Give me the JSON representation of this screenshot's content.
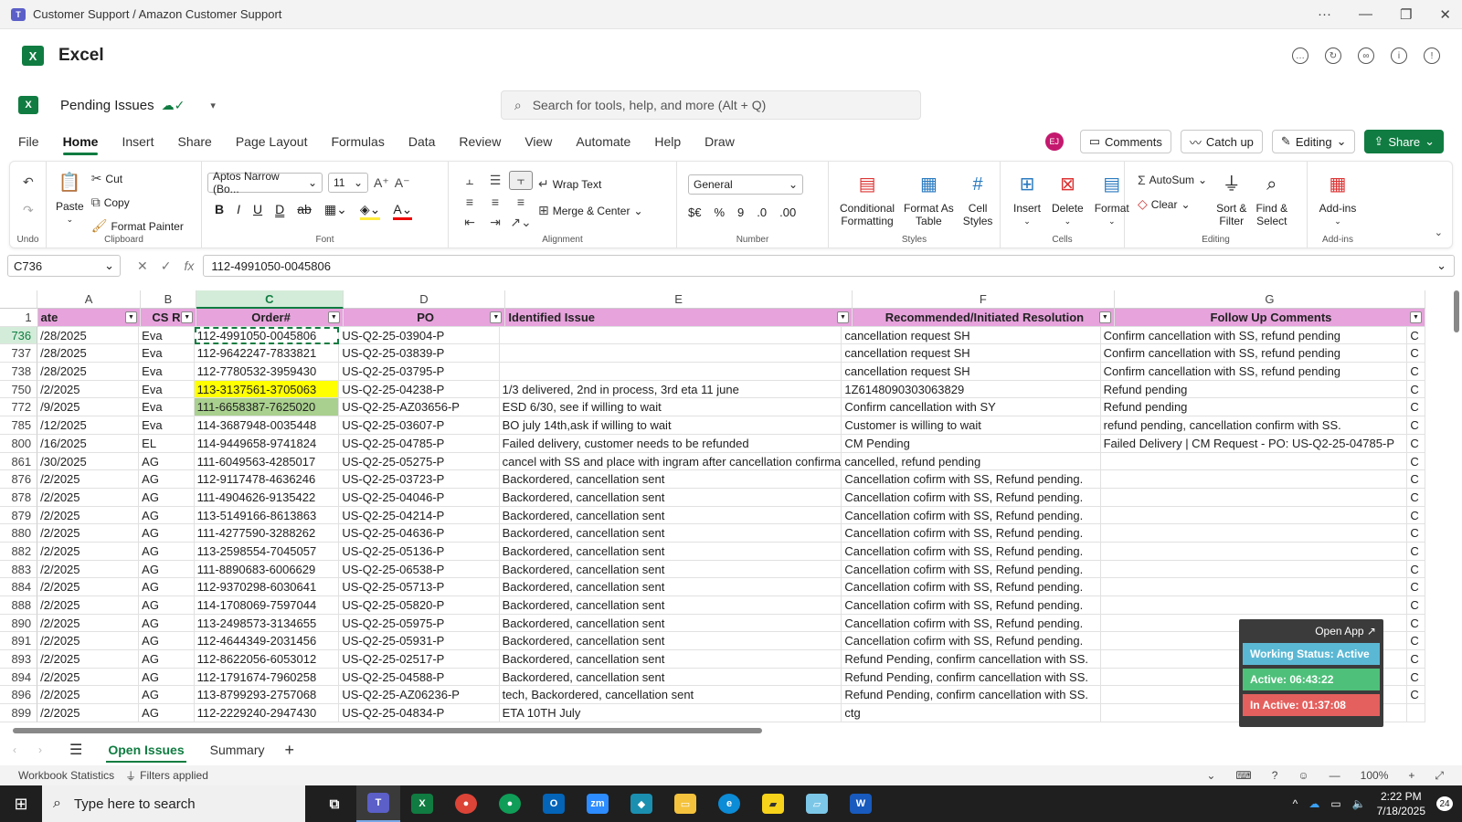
{
  "window": {
    "title": "Customer Support / Amazon Customer Support",
    "controls": [
      "···",
      "—",
      "❐",
      "✕"
    ]
  },
  "app": {
    "name": "Excel",
    "logo": "X"
  },
  "doc": {
    "name": "Pending Issues"
  },
  "search": {
    "placeholder": "Search for tools, help, and more (Alt + Q)"
  },
  "menu": [
    "File",
    "Home",
    "Insert",
    "Share",
    "Page Layout",
    "Formulas",
    "Data",
    "Review",
    "View",
    "Automate",
    "Help",
    "Draw"
  ],
  "header_right": {
    "avatar": "EJ",
    "comments": "Comments",
    "catchup": "Catch up",
    "editing": "Editing",
    "share": "Share"
  },
  "ribbon": {
    "undo_label": "Undo",
    "clipboard": {
      "paste": "Paste",
      "cut": "Cut",
      "copy": "Copy",
      "format_painter": "Format Painter",
      "label": "Clipboard"
    },
    "font": {
      "name": "Aptos Narrow (Bo...",
      "size": "11",
      "label": "Font"
    },
    "alignment": {
      "wrap": "Wrap Text",
      "merge": "Merge & Center",
      "label": "Alignment"
    },
    "number": {
      "format": "General",
      "currency": "$€",
      "percent": "%",
      "comma": "9",
      "label": "Number"
    },
    "styles": {
      "cond1": "Conditional",
      "cond2": "Formatting",
      "fat1": "Format As",
      "fat2": "Table",
      "cs1": "Cell",
      "cs2": "Styles",
      "label": "Styles"
    },
    "cells": {
      "insert": "Insert",
      "delete": "Delete",
      "format": "Format",
      "label": "Cells"
    },
    "editing": {
      "autosum": "AutoSum",
      "clear": "Clear",
      "sort1": "Sort &",
      "sort2": "Filter",
      "find1": "Find &",
      "find2": "Select",
      "label": "Editing"
    },
    "addins": {
      "name": "Add-ins",
      "label": "Add-ins"
    }
  },
  "formula_bar": {
    "namebox": "C736",
    "fx": "fx",
    "value": "112-4991050-0045806"
  },
  "columns": {
    "letters": [
      "A",
      "B",
      "C",
      "D",
      "E",
      "F",
      "G"
    ]
  },
  "header_row": {
    "num": "1",
    "cells": [
      "ate",
      "CS Re",
      "Order#",
      "PO",
      "Identified Issue",
      "Recommended/Initiated Resolution",
      "Follow Up Comments"
    ]
  },
  "rows": [
    {
      "n": "736",
      "a": "/28/2025",
      "b": "Eva",
      "c": "112-4991050-0045806",
      "d": "US-Q2-25-03904-P",
      "e": "",
      "f": "cancellation request SH",
      "g": "Confirm cancellation with SS, refund pending",
      "h": "C"
    },
    {
      "n": "737",
      "a": "/28/2025",
      "b": "Eva",
      "c": "112-9642247-7833821",
      "d": "US-Q2-25-03839-P",
      "e": "",
      "f": "cancellation request SH",
      "g": "Confirm cancellation with SS, refund pending",
      "h": "C"
    },
    {
      "n": "738",
      "a": "/28/2025",
      "b": "Eva",
      "c": "112-7780532-3959430",
      "d": "US-Q2-25-03795-P",
      "e": "",
      "f": "cancellation request SH",
      "g": "Confirm cancellation with SS, refund pending",
      "h": "C"
    },
    {
      "n": "750",
      "a": "/2/2025",
      "b": "Eva",
      "c": "113-3137561-3705063",
      "d": "US-Q2-25-04238-P",
      "e": "1/3 delivered, 2nd in process, 3rd eta 11 june",
      "f": "1Z6148090303063829",
      "g": "Refund pending",
      "h": "C"
    },
    {
      "n": "772",
      "a": "/9/2025",
      "b": "Eva",
      "c": "111-6658387-7625020",
      "d": "US-Q2-25-AZ03656-P",
      "e": "ESD 6/30, see if willing to wait",
      "f": "Confirm cancellation with SY",
      "g": "Refund pending",
      "h": "C"
    },
    {
      "n": "785",
      "a": "/12/2025",
      "b": "Eva",
      "c": "114-3687948-0035448",
      "d": "US-Q2-25-03607-P",
      "e": "BO july 14th,ask if willing to wait",
      "f": "Customer is willing to wait",
      "g": "refund pending, cancellation confirm with SS.",
      "h": "C"
    },
    {
      "n": "800",
      "a": "/16/2025",
      "b": "EL",
      "c": "114-9449658-9741824",
      "d": "US-Q2-25-04785-P",
      "e": "Failed delivery, customer needs to be refunded",
      "f": "CM Pending",
      "g": "Failed Delivery | CM Request - PO: US-Q2-25-04785-P",
      "h": "C"
    },
    {
      "n": "861",
      "a": "/30/2025",
      "b": "AG",
      "c": "111-6049563-4285017",
      "d": "US-Q2-25-05275-P",
      "e": "cancel with SS and place with ingram after cancellation confirma",
      "f": "cancelled, refund pending",
      "g": "",
      "h": "C"
    },
    {
      "n": "876",
      "a": "/2/2025",
      "b": "AG",
      "c": "112-9117478-4636246",
      "d": "US-Q2-25-03723-P",
      "e": "Backordered, cancellation sent",
      "f": "Cancellation cofirm with SS, Refund pending.",
      "g": "",
      "h": "C"
    },
    {
      "n": "878",
      "a": "/2/2025",
      "b": "AG",
      "c": "111-4904626-9135422",
      "d": "US-Q2-25-04046-P",
      "e": "Backordered, cancellation sent",
      "f": "Cancellation cofirm with SS, Refund pending.",
      "g": "",
      "h": "C"
    },
    {
      "n": "879",
      "a": "/2/2025",
      "b": "AG",
      "c": "113-5149166-8613863",
      "d": "US-Q2-25-04214-P",
      "e": "Backordered, cancellation sent",
      "f": "Cancellation cofirm with SS, Refund pending.",
      "g": "",
      "h": "C"
    },
    {
      "n": "880",
      "a": "/2/2025",
      "b": "AG",
      "c": "111-4277590-3288262",
      "d": "US-Q2-25-04636-P",
      "e": "Backordered, cancellation sent",
      "f": "Cancellation cofirm with SS, Refund pending.",
      "g": "",
      "h": "C"
    },
    {
      "n": "882",
      "a": "/2/2025",
      "b": "AG",
      "c": "113-2598554-7045057",
      "d": "US-Q2-25-05136-P",
      "e": "Backordered, cancellation sent",
      "f": "Cancellation cofirm with SS, Refund pending.",
      "g": "",
      "h": "C"
    },
    {
      "n": "883",
      "a": "/2/2025",
      "b": "AG",
      "c": "111-8890683-6006629",
      "d": "US-Q2-25-06538-P",
      "e": "Backordered, cancellation sent",
      "f": "Cancellation cofirm with SS, Refund pending.",
      "g": "",
      "h": "C"
    },
    {
      "n": "884",
      "a": "/2/2025",
      "b": "AG",
      "c": "112-9370298-6030641",
      "d": "US-Q2-25-05713-P",
      "e": "Backordered, cancellation sent",
      "f": "Cancellation cofirm with SS, Refund pending.",
      "g": "",
      "h": "C"
    },
    {
      "n": "888",
      "a": "/2/2025",
      "b": "AG",
      "c": "114-1708069-7597044",
      "d": "US-Q2-25-05820-P",
      "e": "Backordered, cancellation sent",
      "f": "Cancellation cofirm with SS, Refund pending.",
      "g": "",
      "h": "C"
    },
    {
      "n": "890",
      "a": "/2/2025",
      "b": "AG",
      "c": "113-2498573-3134655",
      "d": "US-Q2-25-05975-P",
      "e": "Backordered, cancellation sent",
      "f": "Cancellation cofirm with SS, Refund pending.",
      "g": "",
      "h": "C"
    },
    {
      "n": "891",
      "a": "/2/2025",
      "b": "AG",
      "c": "112-4644349-2031456",
      "d": "US-Q2-25-05931-P",
      "e": "Backordered, cancellation sent",
      "f": "Cancellation cofirm with SS, Refund pending.",
      "g": "",
      "h": "C"
    },
    {
      "n": "893",
      "a": "/2/2025",
      "b": "AG",
      "c": "112-8622056-6053012",
      "d": "US-Q2-25-02517-P",
      "e": "Backordered, cancellation sent",
      "f": "Refund Pending, confirm cancellation with SS.",
      "g": "",
      "h": "C"
    },
    {
      "n": "894",
      "a": "/2/2025",
      "b": "AG",
      "c": "112-1791674-7960258",
      "d": "US-Q2-25-04588-P",
      "e": "Backordered, cancellation sent",
      "f": "Refund Pending, confirm cancellation with SS.",
      "g": "",
      "h": "C"
    },
    {
      "n": "896",
      "a": "/2/2025",
      "b": "AG",
      "c": "113-8799293-2757068",
      "d": "US-Q2-25-AZ06236-P",
      "e": "tech, Backordered, cancellation sent",
      "f": "Refund Pending, confirm cancellation with SS.",
      "g": "",
      "h": "C"
    },
    {
      "n": "899",
      "a": "/2/2025",
      "b": "AG",
      "c": "112-2229240-2947430",
      "d": "US-Q2-25-04834-P",
      "e": "ETA 10TH July",
      "f": "ctg",
      "g": "",
      "h": ""
    }
  ],
  "widget": {
    "open_app": "Open App ↗",
    "status": "Working Status: Active",
    "active": "Active: 06:43:22",
    "inactive": "In Active: 01:37:08",
    "colors": {
      "status": "#5bb8d4",
      "active": "#4fc07a",
      "inactive": "#e4605e"
    }
  },
  "sheets": {
    "tabs": [
      "Open Issues",
      "Summary"
    ],
    "active": "Open Issues"
  },
  "status": {
    "stats": "Workbook Statistics",
    "filters": "Filters applied",
    "zoom": "100%"
  },
  "taskbar": {
    "search": "Type here to search",
    "time": "2:22 PM",
    "date": "7/18/2025",
    "notif": "24"
  },
  "colors": {
    "excel_green": "#107c41",
    "header_fill": "#e6a3dc",
    "yellow": "#ffff00",
    "green_fill": "#a9d08e"
  }
}
